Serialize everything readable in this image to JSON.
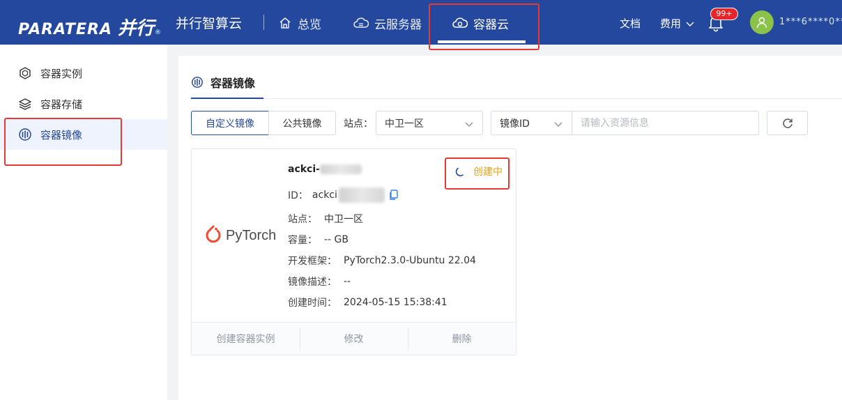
{
  "header": {
    "logo_text": "PARATERA",
    "logo_cn": "并行",
    "logo_mark": "®",
    "brand": "并行智算云",
    "nav": [
      {
        "label": "总览",
        "icon": "home-icon"
      },
      {
        "label": "云服务器",
        "icon": "cloud-server-icon"
      },
      {
        "label": "容器云",
        "icon": "container-cloud-icon",
        "active": true
      }
    ],
    "docs": "文档",
    "fee": "费用",
    "notification_badge": "99+",
    "username": "1***6****0**"
  },
  "sidebar": {
    "items": [
      {
        "label": "容器实例",
        "icon": "container-instance-icon"
      },
      {
        "label": "容器存储",
        "icon": "container-storage-icon"
      },
      {
        "label": "容器镜像",
        "icon": "container-image-icon",
        "active": true
      }
    ]
  },
  "main": {
    "title": "容器镜像",
    "tabs": [
      "自定义镜像",
      "公共镜像"
    ],
    "site_label": "站点：",
    "site_value": "中卫一区",
    "search_type": "镜像ID",
    "search_placeholder": "请输入资源信息"
  },
  "card": {
    "logo_text": "PyTorch",
    "name_prefix": "ackci-",
    "status": "创建中",
    "id_label": "ID：",
    "id_prefix": "ackci",
    "site_label": "站点：",
    "site": "中卫一区",
    "capacity_label": "容量：",
    "capacity": "-- GB",
    "framework_label": "开发框架：",
    "framework": "PyTorch2.3.0-Ubuntu 22.04",
    "desc_label": "镜像描述：",
    "desc": "--",
    "created_label": "创建时间：",
    "created": "2024-05-15 15:38:41",
    "actions": [
      "创建容器实例",
      "修改",
      "删除"
    ]
  },
  "colors": {
    "header_bg": "#23489e",
    "accent": "#23489e",
    "status_creating": "#e8a317",
    "annotation_red": "#e53935",
    "pytorch": "#ee4c2c"
  }
}
